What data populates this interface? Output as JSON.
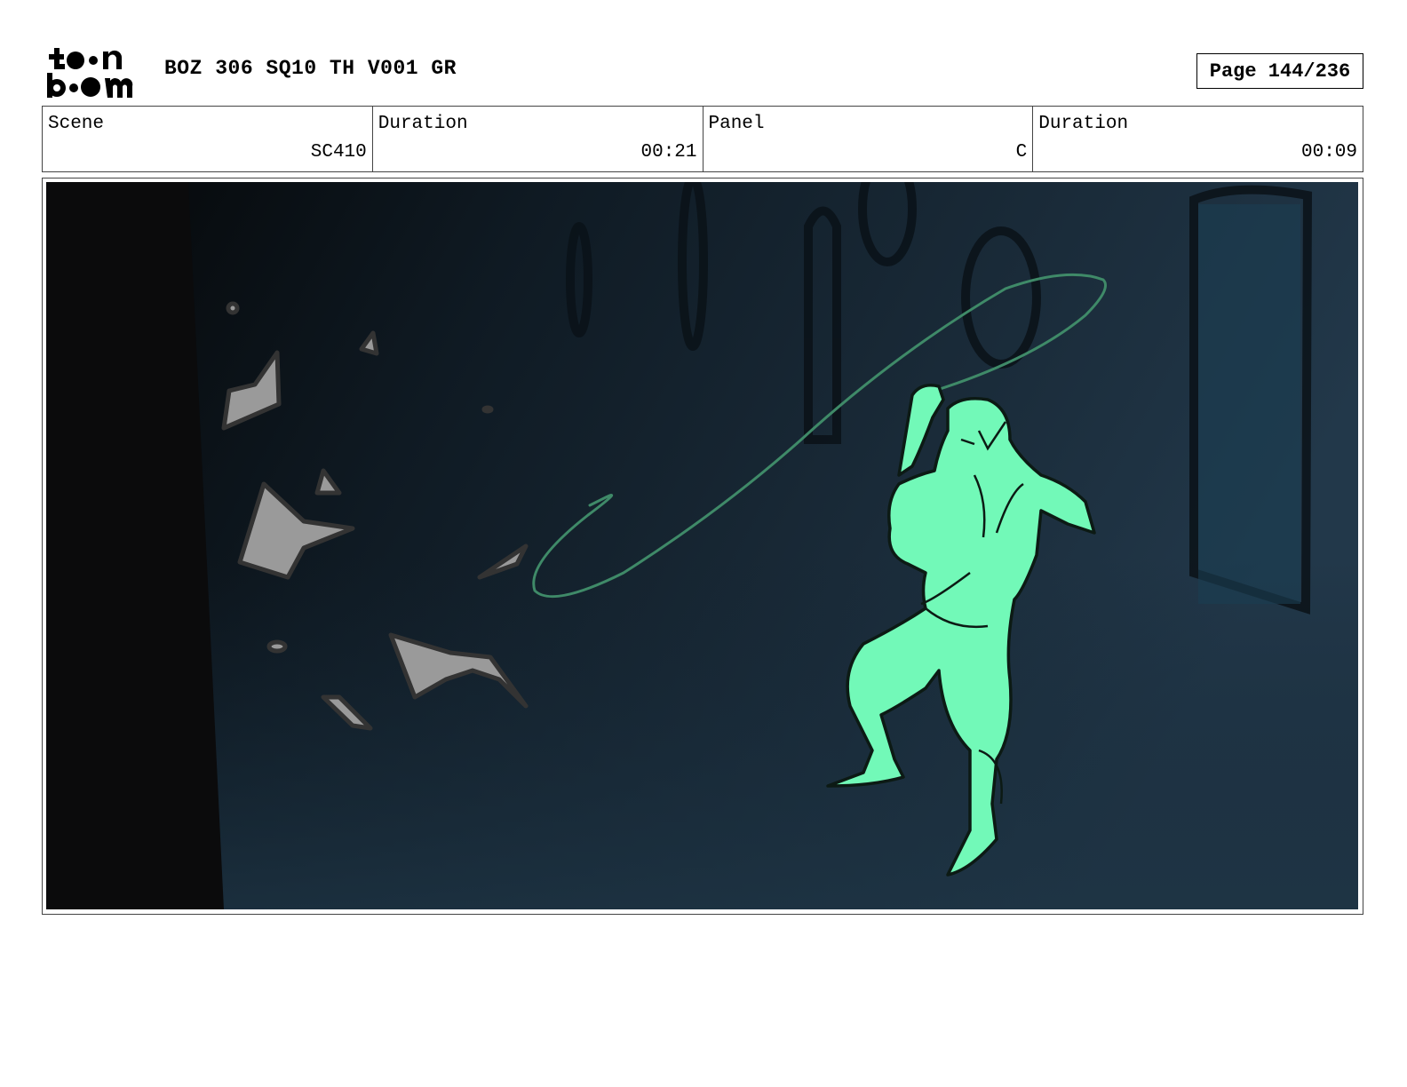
{
  "header": {
    "logo_icon": "toon-boom-logo-icon",
    "project_title": "BOZ 306 SQ10 TH V001 GR",
    "page": "Page 144/236"
  },
  "info": {
    "scene_label": "Scene",
    "scene_value": "SC410",
    "scene_duration_label": "Duration",
    "scene_duration_value": "00:21",
    "panel_label": "Panel",
    "panel_value": "C",
    "panel_duration_label": "Duration",
    "panel_duration_value": "00:09"
  },
  "panel": {
    "background_color": "#1b2b38",
    "figure_color": "#72f9b8",
    "shard_color": "#9a9a9a",
    "whip_color": "#3f8a68"
  }
}
